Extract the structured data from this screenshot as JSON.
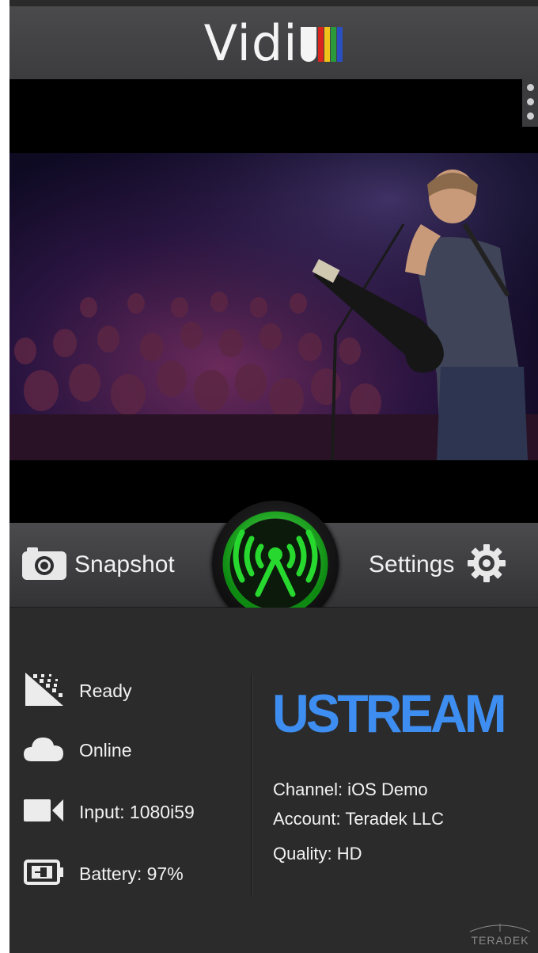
{
  "header": {
    "logo_text": "Vidi",
    "logo_bar_colors": [
      "#d8261f",
      "#f0c21a",
      "#2a9a3a",
      "#2a4fc0"
    ]
  },
  "video": {
    "menu_icon": "more-vertical-icon"
  },
  "controls": {
    "snapshot_label": "Snapshot",
    "snapshot_icon": "camera-icon",
    "settings_label": "Settings",
    "settings_icon": "gear-icon",
    "broadcast_icon": "broadcast-antenna-icon",
    "broadcast_color": "#22d32a"
  },
  "status": {
    "items": [
      {
        "label": "Ready",
        "icon": "signal-pattern-icon"
      },
      {
        "label": "Online",
        "icon": "cloud-icon"
      },
      {
        "label": "Input: 1080i59",
        "icon": "video-camera-icon"
      },
      {
        "label": "Battery: 97%",
        "icon": "battery-plug-icon"
      }
    ],
    "service_name": "USTREAM",
    "service_color": "#3d8ef0",
    "channel": "Channel: iOS Demo",
    "account": "Account: Teradek LLC",
    "quality": "Quality: HD"
  },
  "footer": {
    "brand": "TERADEK"
  }
}
